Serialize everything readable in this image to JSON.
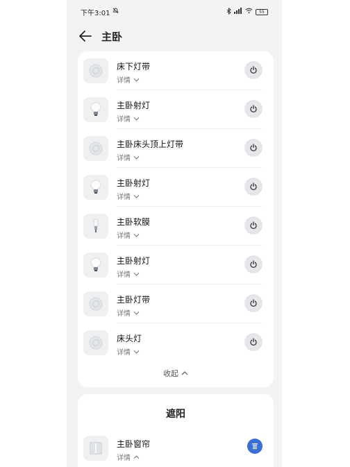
{
  "status_bar": {
    "time": "下午3:01",
    "battery": "55"
  },
  "header": {
    "title": "主卧"
  },
  "devices": [
    {
      "name": "床下灯带",
      "detail": "详情",
      "icon": "light-strip-icon"
    },
    {
      "name": "主卧射灯",
      "detail": "详情",
      "icon": "bulb-icon"
    },
    {
      "name": "主卧床头顶上灯带",
      "detail": "详情",
      "icon": "light-strip-icon"
    },
    {
      "name": "主卧射灯",
      "detail": "详情",
      "icon": "bulb-icon"
    },
    {
      "name": "主卧软膜",
      "detail": "详情",
      "icon": "soft-film-light-icon"
    },
    {
      "name": "主卧射灯",
      "detail": "详情",
      "icon": "bulb-icon"
    },
    {
      "name": "主卧灯带",
      "detail": "详情",
      "icon": "light-strip-icon"
    },
    {
      "name": "床头灯",
      "detail": "详情",
      "icon": "light-strip-icon"
    }
  ],
  "collapse_label": "收起",
  "shade_section": {
    "title": "遮阳",
    "device": {
      "name": "主卧窗帘",
      "detail": "详情",
      "icon": "curtain-icon"
    }
  },
  "colors": {
    "accent": "#3b6fd8",
    "card": "#ffffff",
    "background": "#f1f3f5"
  }
}
